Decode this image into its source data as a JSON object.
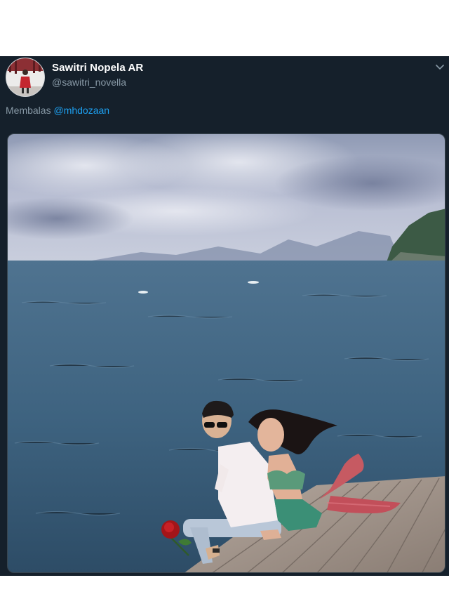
{
  "tweet": {
    "author": {
      "display_name": "Sawitri Nopela AR",
      "handle": "@sawitri_novella"
    },
    "reply": {
      "prefix": "Membalas",
      "mention": "@mhdozaan"
    },
    "menu_icon": "chevron-down-icon"
  },
  "colors": {
    "tweet_background": "#15202b",
    "link_blue": "#1da1f2",
    "secondary_text": "#8899a6"
  }
}
